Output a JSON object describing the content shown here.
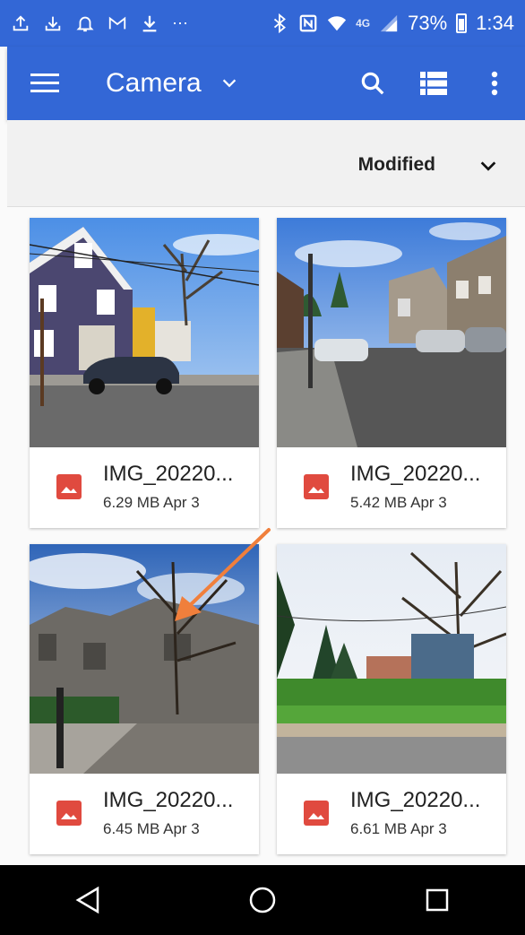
{
  "status_bar": {
    "battery": "73%",
    "time": "1:34",
    "network": "4G",
    "icons": [
      "upload-icon",
      "download-icon",
      "notification-icon",
      "gmail-icon",
      "download-arrow-icon",
      "bluetooth-icon",
      "nfc-icon",
      "wifi-icon",
      "signal-icon",
      "battery-icon"
    ]
  },
  "app_bar": {
    "title": "Camera",
    "icons": [
      "menu-icon",
      "chevron-down-icon",
      "search-icon",
      "list-view-icon",
      "more-vert-icon"
    ],
    "color": "#3367d6"
  },
  "sort": {
    "label": "Modified"
  },
  "files": [
    {
      "name": "IMG_20220...",
      "size": "6.29 MB",
      "date": "Apr 3"
    },
    {
      "name": "IMG_20220...",
      "size": "5.42 MB",
      "date": "Apr 3"
    },
    {
      "name": "IMG_20220...",
      "size": "6.45 MB",
      "date": "Apr 3"
    },
    {
      "name": "IMG_20220...",
      "size": "6.61 MB",
      "date": "Apr 3"
    }
  ],
  "file_icon_color": "#e04a3f",
  "nav": {
    "icons": [
      "back-icon",
      "home-icon",
      "recents-icon"
    ]
  }
}
